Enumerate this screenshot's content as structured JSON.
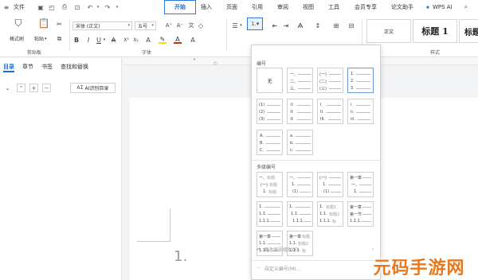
{
  "menubar": {
    "file_label": "文件",
    "tabs": [
      "开始",
      "插入",
      "页面",
      "引用",
      "审阅",
      "视图",
      "工具",
      "会员专享",
      "论文助手"
    ],
    "active_tab": "开始",
    "wps_ai_label": "WPS AI"
  },
  "ribbon": {
    "format_painter": "格式刷",
    "paste": "粘贴",
    "clipboard_group": "剪贴板",
    "font_name": "宋体 (正文)",
    "font_size": "五号",
    "font_group": "字体",
    "style_group": "样式",
    "styles": [
      "正文",
      "标题 1",
      "标题"
    ]
  },
  "navpane": {
    "tabs": [
      "目录",
      "章节",
      "书签",
      "查找和替换"
    ],
    "active_tab": "目录",
    "ai_button": "AI识别目录"
  },
  "document": {
    "page_number_text": "1."
  },
  "dropdown": {
    "numbering_title": "编号",
    "none_label": "无",
    "multilevel_title": "多级编号",
    "change_multilevel": "更改编号级别(E)",
    "custom_numbering": "自定义编号(M)..."
  },
  "watermark": "元码手游网",
  "colors": {
    "accent": "#1a6fe0",
    "watermark": "#e8781e"
  }
}
